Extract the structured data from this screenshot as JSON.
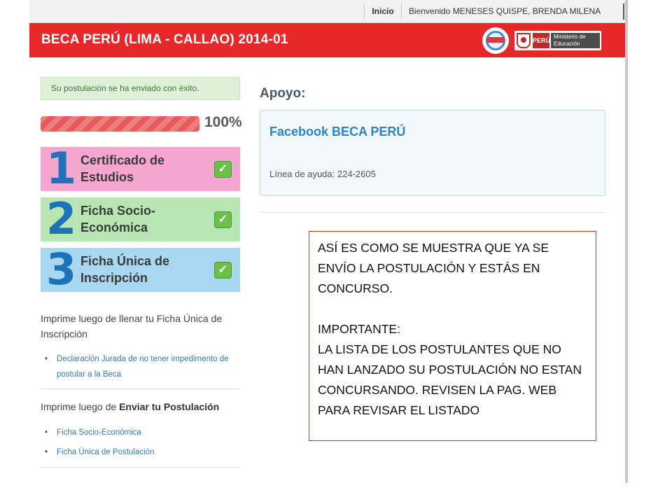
{
  "topbar": {
    "home_link": "Inicio",
    "welcome_prefix": "Bienvenido",
    "user_name": "MENESES QUISPE, BRENDA MILENA"
  },
  "header": {
    "title": "BECA PERÚ (LIMA - CALLAO) 2014-01",
    "gov_flag_text": "PERÚ",
    "ministry_text": "Ministerio de Educación",
    "colors": {
      "header_red": "#e5292a"
    }
  },
  "status": {
    "success_message": "Su postulación se ha enviado con éxito.",
    "progress_percent": 100,
    "progress_label": "100%"
  },
  "steps": [
    {
      "number": "1",
      "label": "Certificado de Estudios",
      "completed": true,
      "color": "#f4a6cf"
    },
    {
      "number": "2",
      "label": "Ficha Socio-Económica",
      "completed": true,
      "color": "#b8e6b3"
    },
    {
      "number": "3",
      "label": "Ficha Única de Inscripción",
      "completed": true,
      "color": "#a8d8ef"
    }
  ],
  "print_section_1": {
    "heading": "Imprime luego de llenar tu Ficha Única de Inscripción",
    "links": [
      "Declaración Jurada de no tener impedimento de postular a la Beca"
    ]
  },
  "print_section_2": {
    "heading_prefix": "Imprime luego de",
    "heading_bold": "Enviar tu Postulación",
    "links": [
      "Ficha Socio-Económica",
      "Ficha Única de Postulación"
    ]
  },
  "support": {
    "title": "Apoyo:",
    "facebook_link": "Facebook BECA PERÚ",
    "helpline_label": "Línea de ayuda:",
    "helpline_number": "224-2605"
  },
  "annotation": {
    "line1": "ASÍ ES COMO SE MUESTRA QUE YA SE ENVÍO LA POSTULACIÓN Y ESTÁS EN CONCURSO.",
    "heading": "IMPORTANTE:",
    "body": "LA LISTA DE LOS POSTULANTES QUE NO HAN LANZADO SU POSTULACIÓN NO ESTAN CONCURSANDO. REVISEN LA PAG. WEB PARA REVISAR EL LISTADO"
  }
}
